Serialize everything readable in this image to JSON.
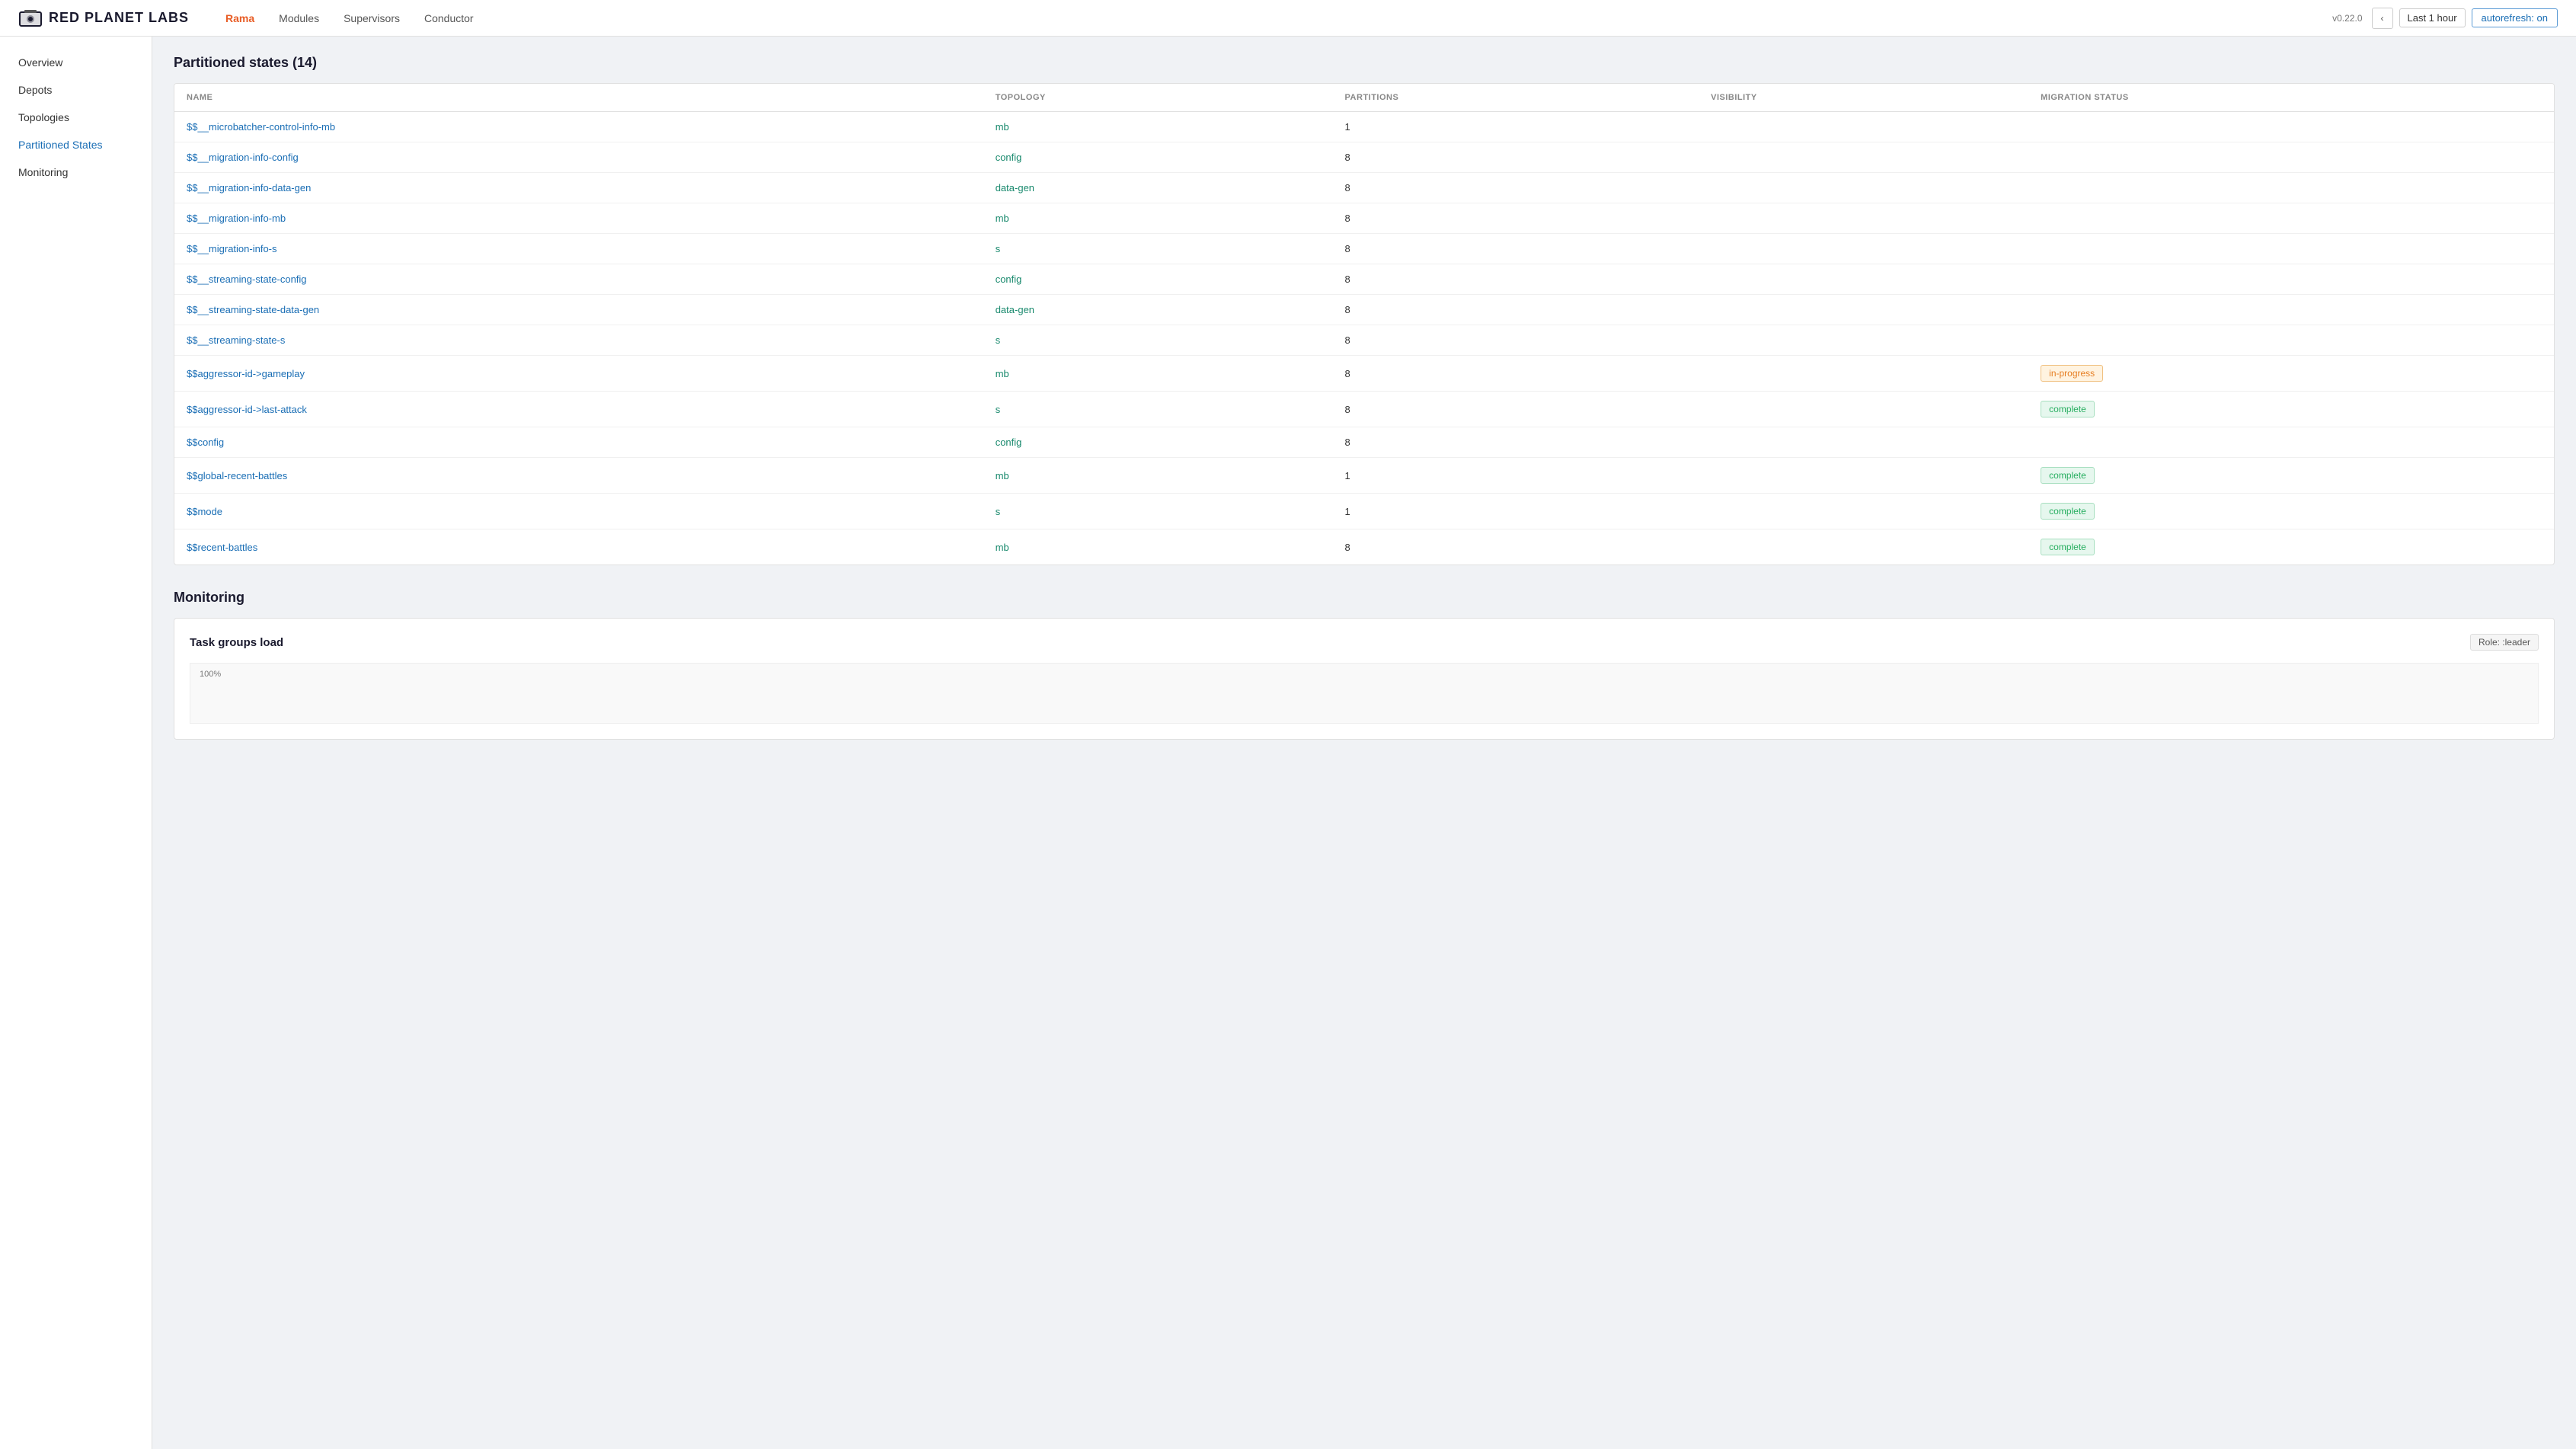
{
  "header": {
    "logo_text": "RED PLANET LABS",
    "version": "v0.22.0",
    "nav_items": [
      {
        "id": "rama",
        "label": "Rama",
        "active": true
      },
      {
        "id": "modules",
        "label": "Modules",
        "active": false
      },
      {
        "id": "supervisors",
        "label": "Supervisors",
        "active": false
      },
      {
        "id": "conductor",
        "label": "Conductor",
        "active": false
      }
    ],
    "time_range": "Last 1 hour",
    "autorefresh_label": "autorefresh: on"
  },
  "sidebar": {
    "items": [
      {
        "id": "overview",
        "label": "Overview",
        "active": false
      },
      {
        "id": "depots",
        "label": "Depots",
        "active": false
      },
      {
        "id": "topologies",
        "label": "Topologies",
        "active": false
      },
      {
        "id": "partitioned-states",
        "label": "Partitioned States",
        "active": true
      },
      {
        "id": "monitoring",
        "label": "Monitoring",
        "active": false
      }
    ]
  },
  "partitioned_states": {
    "section_title": "Partitioned states (14)",
    "table": {
      "columns": [
        {
          "id": "name",
          "label": "NAME"
        },
        {
          "id": "topology",
          "label": "TOPOLOGY"
        },
        {
          "id": "partitions",
          "label": "PARTITIONS"
        },
        {
          "id": "visibility",
          "label": "VISIBILITY"
        },
        {
          "id": "migration_status",
          "label": "MIGRATION STATUS"
        }
      ],
      "rows": [
        {
          "name": "$$__microbatcher-control-info-mb",
          "topology": "mb",
          "partitions": "1",
          "visibility": "",
          "migration_status": ""
        },
        {
          "name": "$$__migration-info-config",
          "topology": "config",
          "partitions": "8",
          "visibility": "",
          "migration_status": ""
        },
        {
          "name": "$$__migration-info-data-gen",
          "topology": "data-gen",
          "partitions": "8",
          "visibility": "",
          "migration_status": ""
        },
        {
          "name": "$$__migration-info-mb",
          "topology": "mb",
          "partitions": "8",
          "visibility": "",
          "migration_status": ""
        },
        {
          "name": "$$__migration-info-s",
          "topology": "s",
          "partitions": "8",
          "visibility": "",
          "migration_status": ""
        },
        {
          "name": "$$__streaming-state-config",
          "topology": "config",
          "partitions": "8",
          "visibility": "",
          "migration_status": ""
        },
        {
          "name": "$$__streaming-state-data-gen",
          "topology": "data-gen",
          "partitions": "8",
          "visibility": "",
          "migration_status": ""
        },
        {
          "name": "$$__streaming-state-s",
          "topology": "s",
          "partitions": "8",
          "visibility": "",
          "migration_status": ""
        },
        {
          "name": "$$aggressor-id->gameplay",
          "topology": "mb",
          "partitions": "8",
          "visibility": "",
          "migration_status": "in-progress"
        },
        {
          "name": "$$aggressor-id->last-attack",
          "topology": "s",
          "partitions": "8",
          "visibility": "",
          "migration_status": "complete"
        },
        {
          "name": "$$config",
          "topology": "config",
          "partitions": "8",
          "visibility": "",
          "migration_status": ""
        },
        {
          "name": "$$global-recent-battles",
          "topology": "mb",
          "partitions": "1",
          "visibility": "",
          "migration_status": "complete"
        },
        {
          "name": "$$mode",
          "topology": "s",
          "partitions": "1",
          "visibility": "",
          "migration_status": "complete"
        },
        {
          "name": "$$recent-battles",
          "topology": "mb",
          "partitions": "8",
          "visibility": "",
          "migration_status": "complete"
        }
      ]
    }
  },
  "monitoring": {
    "section_title": "Monitoring",
    "task_groups_load": {
      "title": "Task groups load",
      "role_label": "Role: :leader",
      "chart_y_label": "100%"
    }
  }
}
